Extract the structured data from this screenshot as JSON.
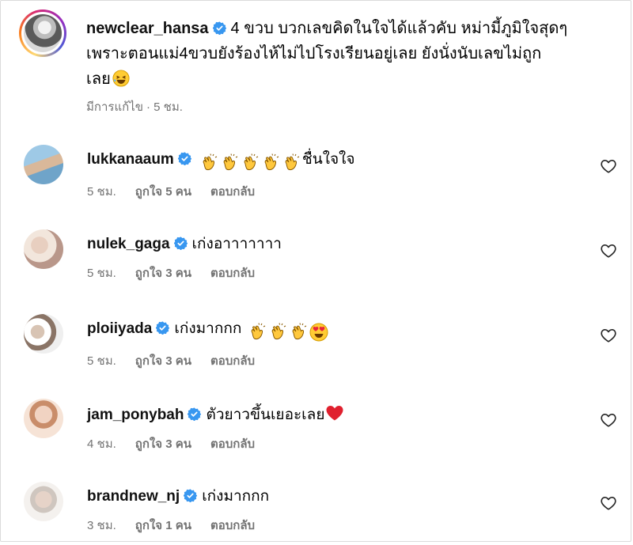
{
  "post": {
    "username": "newclear_hansa",
    "caption_line1": "4 ขวบ บวกเลขคิดในใจได้แล้วคับ หม่ามี้ภูมิใจสุดๆ",
    "caption_line2": "เพราะตอนแม่4ขวบยังร้องไห้ไม่ไปโรงเรียนอยู่เลย ยังนั่งนับเลขไม่ถูก",
    "caption_line3": "เลย",
    "edited_label": "มีการแก้ไข",
    "time": "· 5 ชม."
  },
  "comments": [
    {
      "username": "lukkanaaum",
      "text": "ชื่นใจใจ",
      "emojis": [
        "clap-emoji",
        "clap-emoji",
        "clap-emoji",
        "clap-emoji",
        "clap-emoji"
      ],
      "time": "5 ชม.",
      "likes": "ถูกใจ 5 คน",
      "reply": "ตอบกลับ"
    },
    {
      "username": "nulek_gaga",
      "text": "เก่งอาาาาาาา",
      "emojis": [],
      "time": "5 ชม.",
      "likes": "ถูกใจ 3 คน",
      "reply": "ตอบกลับ"
    },
    {
      "username": "ploiiyada",
      "text": "เก่งมากกก",
      "emojis": [
        "clap-emoji",
        "clap-emoji",
        "clap-emoji",
        "heart-eyes-emoji"
      ],
      "time": "5 ชม.",
      "likes": "ถูกใจ 3 คน",
      "reply": "ตอบกลับ"
    },
    {
      "username": "jam_ponybah",
      "text": "ตัวยาวขึ้นเยอะเลย",
      "emojis": [
        "red-heart-emoji"
      ],
      "time": "4 ชม.",
      "likes": "ถูกใจ 3 คน",
      "reply": "ตอบกลับ"
    },
    {
      "username": "brandnew_nj",
      "text": "เก่งมากกก",
      "emojis": [],
      "time": "3 ชม.",
      "likes": "ถูกใจ 1 คน",
      "reply": "ตอบกลับ"
    }
  ],
  "colors": {
    "verified": "#3897f0",
    "muted_text": "#737373",
    "text": "#000000"
  }
}
